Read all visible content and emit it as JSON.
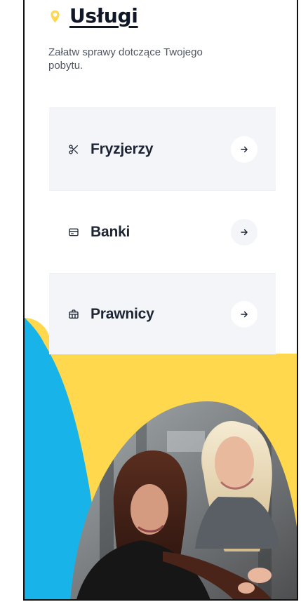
{
  "header": {
    "title": "Usługi",
    "pin_icon": "map-pin-icon",
    "subtitle": "Załatw sprawy dotczące Twojego pobytu."
  },
  "services": [
    {
      "label": "Fryzjerzy",
      "icon": "scissors-icon",
      "arrow_icon": "arrow-right-icon"
    },
    {
      "label": "Banki",
      "icon": "credit-card-icon",
      "arrow_icon": "arrow-right-icon"
    },
    {
      "label": "Prawnicy",
      "icon": "briefcase-icon",
      "arrow_icon": "arrow-right-icon"
    }
  ],
  "colors": {
    "yellow": "#FFD84D",
    "blue": "#18B3E8",
    "card_light": "#F3F5F8",
    "text_dark": "#1D2433",
    "text_muted": "#4F5562"
  }
}
